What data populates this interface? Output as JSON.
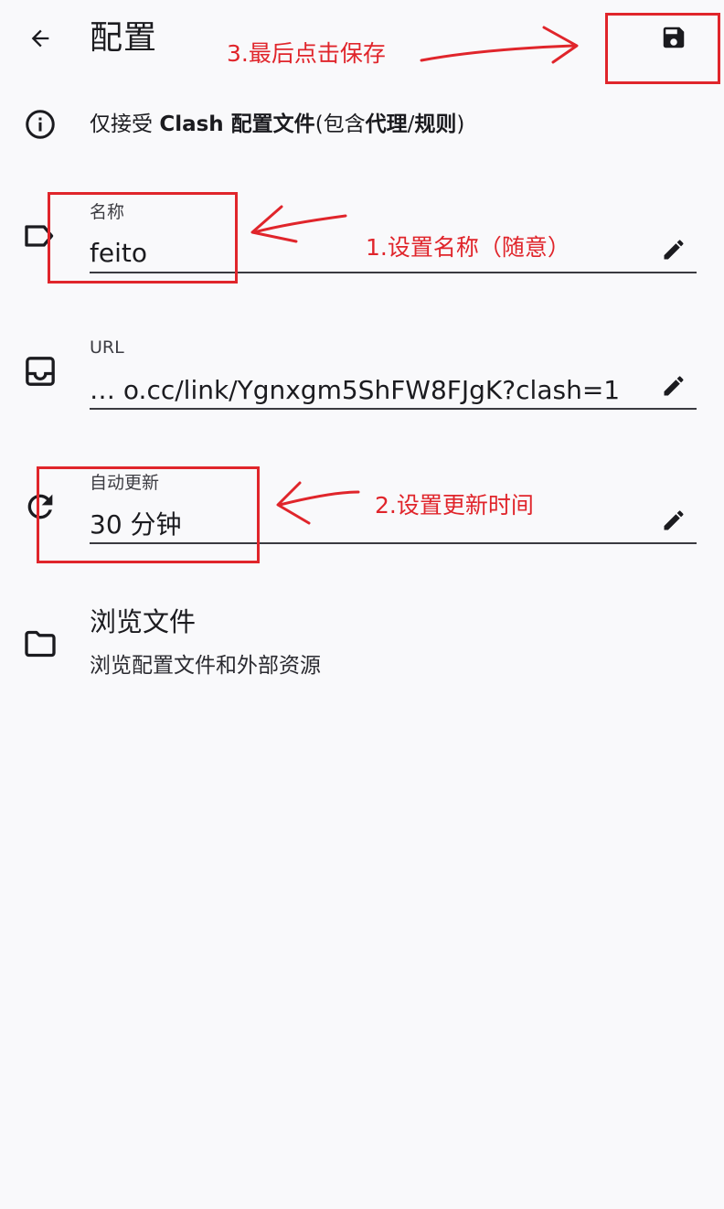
{
  "appbar": {
    "title": "配置",
    "back_icon": "arrow-back-icon",
    "save_icon": "save-icon"
  },
  "info": {
    "text_prefix": "仅接受 ",
    "text_bold1": "Clash",
    "text_mid": " 配置文件",
    "text_paren_open": "(包含",
    "text_bold2": "代理",
    "text_slash": "/",
    "text_bold3": "规则",
    "text_paren_close": ")",
    "icon": "info-icon"
  },
  "fields": {
    "name": {
      "label": "名称",
      "value": "feito",
      "icon": "label-outline-icon"
    },
    "url": {
      "label": "URL",
      "value": "…  o.cc/link/Ygnxgm5ShFW8FJgK?clash=1",
      "icon": "inbox-icon"
    },
    "auto_update": {
      "label": "自动更新",
      "value": "30 分钟",
      "icon": "refresh-icon"
    }
  },
  "browse": {
    "title": "浏览文件",
    "description": "浏览配置文件和外部资源",
    "icon": "folder-icon"
  },
  "annotations": {
    "step1": "1.设置名称（随意）",
    "step2": "2.设置更新时间",
    "step3": "3.最后点击保存",
    "color": "#e0252b"
  }
}
